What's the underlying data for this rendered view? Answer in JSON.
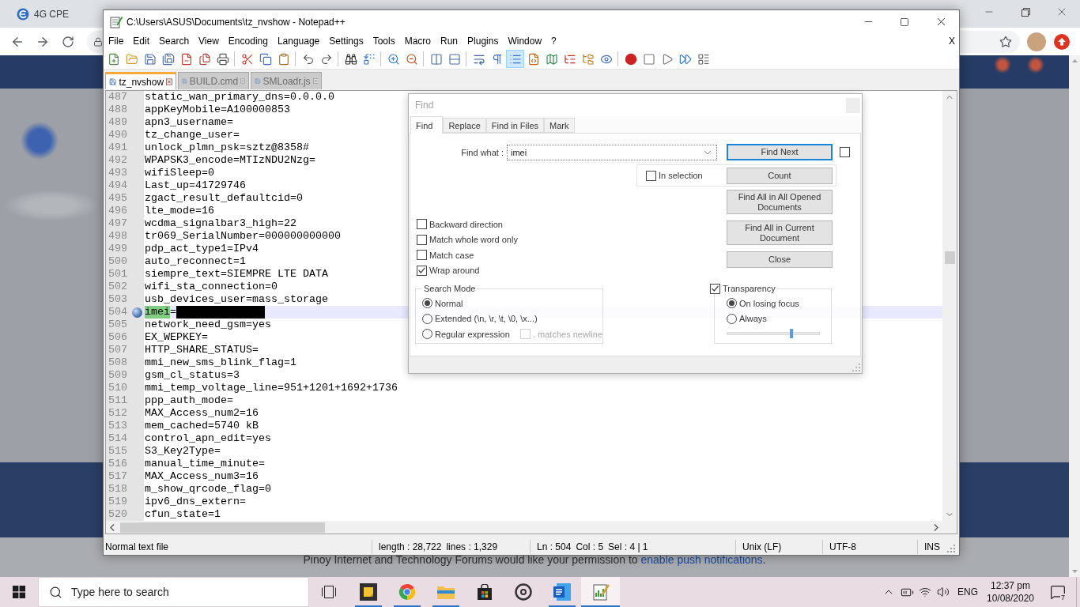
{
  "browser": {
    "tabs": [
      {
        "title": "4G CPE",
        "selected": false
      }
    ],
    "notification": {
      "text": "Pinoy Internet and Technology Forums would like your permission to ",
      "link": "enable push notifications",
      "end": "."
    }
  },
  "window": {
    "title": "C:\\Users\\ASUS\\Documents\\tz_nvshow - Notepad++"
  },
  "menu": {
    "items": [
      "File",
      "Edit",
      "Search",
      "View",
      "Encoding",
      "Language",
      "Settings",
      "Tools",
      "Macro",
      "Run",
      "Plugins",
      "Window",
      "?"
    ],
    "close": "X"
  },
  "toolbar": [
    {
      "pressed": false
    },
    {
      "pressed": false
    },
    {
      "pressed": false
    },
    {
      "pressed": false
    },
    {
      "pressed": false
    },
    {
      "pressed": false
    },
    {
      "pressed": false
    },
    {
      "pressed": false
    },
    {
      "pressed": false
    },
    {
      "pressed": false
    },
    {
      "pressed": false
    },
    {
      "pressed": false
    },
    {
      "pressed": false
    },
    {
      "pressed": false
    },
    {
      "pressed": false
    },
    {
      "pressed": false
    },
    {
      "pressed": false
    },
    {
      "pressed": false
    },
    {
      "pressed": false
    },
    {
      "pressed": false
    },
    {
      "pressed": true
    },
    {
      "pressed": false
    },
    {
      "pressed": false
    },
    {
      "pressed": false
    },
    {
      "pressed": false
    },
    {
      "pressed": false
    },
    {
      "pressed": false
    },
    {
      "pressed": false
    },
    {
      "pressed": false
    },
    {
      "pressed": false
    },
    {
      "pressed": false
    }
  ],
  "doc_tabs": [
    {
      "label": "tz_nvshow",
      "selected": true
    },
    {
      "label": "BUILD.cmd",
      "selected": false
    },
    {
      "label": "SMLoadr.js",
      "selected": false
    }
  ],
  "editor": {
    "lines": [
      {
        "number": "487",
        "text": "static_wan_primary_dns=0.0.0.0",
        "current": false,
        "bookmark": false,
        "redacted": false
      },
      {
        "number": "488",
        "text": "appKeyMobile=A100000853",
        "current": false,
        "bookmark": false,
        "redacted": false
      },
      {
        "number": "489",
        "text": "apn3_username=",
        "current": false,
        "bookmark": false,
        "redacted": false
      },
      {
        "number": "490",
        "text": "tz_change_user=",
        "current": false,
        "bookmark": false,
        "redacted": false
      },
      {
        "number": "491",
        "text": "unlock_plmn_psk=sztz@8358#",
        "current": false,
        "bookmark": false,
        "redacted": false
      },
      {
        "number": "492",
        "text": "WPAPSK3_encode=MTIzNDU2Nzg=",
        "current": false,
        "bookmark": false,
        "redacted": false
      },
      {
        "number": "493",
        "text": "wifiSleep=0",
        "current": false,
        "bookmark": false,
        "redacted": false
      },
      {
        "number": "494",
        "text": "Last_up=41729746",
        "current": false,
        "bookmark": false,
        "redacted": false
      },
      {
        "number": "495",
        "text": "zgact_result_defaultcid=0",
        "current": false,
        "bookmark": false,
        "redacted": false
      },
      {
        "number": "496",
        "text": "lte_mode=16",
        "current": false,
        "bookmark": false,
        "redacted": false
      },
      {
        "number": "497",
        "text": "wcdma_signalbar3_high=22",
        "current": false,
        "bookmark": false,
        "redacted": false
      },
      {
        "number": "498",
        "text": "tr069_SerialNumber=000000000000",
        "current": false,
        "bookmark": false,
        "redacted": false
      },
      {
        "number": "499",
        "text": "pdp_act_type1=IPv4",
        "current": false,
        "bookmark": false,
        "redacted": false
      },
      {
        "number": "500",
        "text": "auto_reconnect=1",
        "current": false,
        "bookmark": false,
        "redacted": false
      },
      {
        "number": "501",
        "text": "siempre_text=SIEMPRE LTE DATA",
        "current": false,
        "bookmark": false,
        "redacted": false
      },
      {
        "number": "502",
        "text": "wifi_sta_connection=0",
        "current": false,
        "bookmark": false,
        "redacted": false
      },
      {
        "number": "503",
        "text": "usb_devices_user=mass_storage",
        "current": false,
        "bookmark": false,
        "redacted": false
      },
      {
        "number": "504",
        "match": "imei",
        "text": "=",
        "current": true,
        "bookmark": true,
        "redacted": true
      },
      {
        "number": "505",
        "text": "network_need_gsm=yes",
        "current": false,
        "bookmark": false,
        "redacted": false
      },
      {
        "number": "506",
        "text": "EX_WEPKEY=",
        "current": false,
        "bookmark": false,
        "redacted": false
      },
      {
        "number": "507",
        "text": "HTTP_SHARE_STATUS=",
        "current": false,
        "bookmark": false,
        "redacted": false
      },
      {
        "number": "508",
        "text": "mmi_new_sms_blink_flag=1",
        "current": false,
        "bookmark": false,
        "redacted": false
      },
      {
        "number": "509",
        "text": "gsm_cl_status=3",
        "current": false,
        "bookmark": false,
        "redacted": false
      },
      {
        "number": "510",
        "text": "mmi_temp_voltage_line=951+1201+1692+1736",
        "current": false,
        "bookmark": false,
        "redacted": false
      },
      {
        "number": "511",
        "text": "ppp_auth_mode=",
        "current": false,
        "bookmark": false,
        "redacted": false
      },
      {
        "number": "512",
        "text": "MAX_Access_num2=16",
        "current": false,
        "bookmark": false,
        "redacted": false
      },
      {
        "number": "513",
        "text": "mem_cached=5740 kB",
        "current": false,
        "bookmark": false,
        "redacted": false
      },
      {
        "number": "514",
        "text": "control_apn_edit=yes",
        "current": false,
        "bookmark": false,
        "redacted": false
      },
      {
        "number": "515",
        "text": "S3_Key2Type=",
        "current": false,
        "bookmark": false,
        "redacted": false
      },
      {
        "number": "516",
        "text": "manual_time_minute=",
        "current": false,
        "bookmark": false,
        "redacted": false
      },
      {
        "number": "517",
        "text": "MAX_Access_num3=16",
        "current": false,
        "bookmark": false,
        "redacted": false
      },
      {
        "number": "518",
        "text": "m_show_qrcode_flag=0",
        "current": false,
        "bookmark": false,
        "redacted": false
      },
      {
        "number": "519",
        "text": "ipv6_dns_extern=",
        "current": false,
        "bookmark": false,
        "redacted": false
      },
      {
        "number": "520",
        "text": "cfun_state=1",
        "current": false,
        "bookmark": false,
        "redacted": false
      }
    ]
  },
  "find_dialog": {
    "title": "Find",
    "tabs": [
      {
        "label": "Find",
        "selected": true
      },
      {
        "label": "Replace",
        "selected": false
      },
      {
        "label": "Find in Files",
        "selected": false
      },
      {
        "label": "Mark",
        "selected": false
      }
    ],
    "find_what": {
      "label": "Find what :",
      "value": "imei"
    },
    "buttons": [
      {
        "label": "Find Next",
        "default": true
      },
      {
        "label": "Count",
        "default": false
      },
      {
        "label": "Find All in All Opened Documents",
        "default": false
      },
      {
        "label": "Find All in Current Document",
        "default": false
      },
      {
        "label": "Close",
        "default": false
      }
    ],
    "side_checkbox": {
      "checked": false
    },
    "in_selection": {
      "label": "In selection",
      "checked": false
    },
    "options": [
      {
        "label": "Backward direction",
        "checked": false
      },
      {
        "label": "Match whole word only",
        "checked": false
      },
      {
        "label": "Match case",
        "checked": false
      },
      {
        "label": "Wrap around",
        "checked": true
      }
    ],
    "search_mode": {
      "title": "Search Mode",
      "modes": [
        {
          "label": "Normal",
          "selected": true
        },
        {
          "label": "Extended (\\n, \\r, \\t, \\0, \\x...)",
          "selected": false
        },
        {
          "label": "Regular expression",
          "selected": false
        }
      ],
      "dot_newline": {
        "label": ". matches newline",
        "checked": false,
        "disabled": true
      }
    },
    "transparency": {
      "label": "Transparency",
      "checked": true,
      "modes": [
        {
          "label": "On losing focus",
          "selected": true
        },
        {
          "label": "Always",
          "selected": false
        }
      ],
      "level": 0.7
    }
  },
  "status_bar": {
    "file_type": "Normal text file",
    "length": "length : 28,722",
    "lines": "lines : 1,329",
    "ln": "Ln : 504",
    "col": "Col : 5",
    "sel": "Sel : 4 | 1",
    "eol": "Unix (LF)",
    "encoding": "UTF-8",
    "mode": "INS"
  },
  "taskbar": {
    "search": {
      "placeholder": "Type here to search"
    },
    "apps": [
      {
        "running": true,
        "active": false
      },
      {
        "running": true,
        "active": false
      },
      {
        "running": true,
        "active": false
      },
      {
        "running": false,
        "active": false
      },
      {
        "running": false,
        "active": false
      },
      {
        "running": true,
        "active": false
      },
      {
        "running": true,
        "active": true
      }
    ],
    "language": "ENG",
    "time": "12:37 pm",
    "date": "10/08/2020",
    "notification_count": "7"
  }
}
